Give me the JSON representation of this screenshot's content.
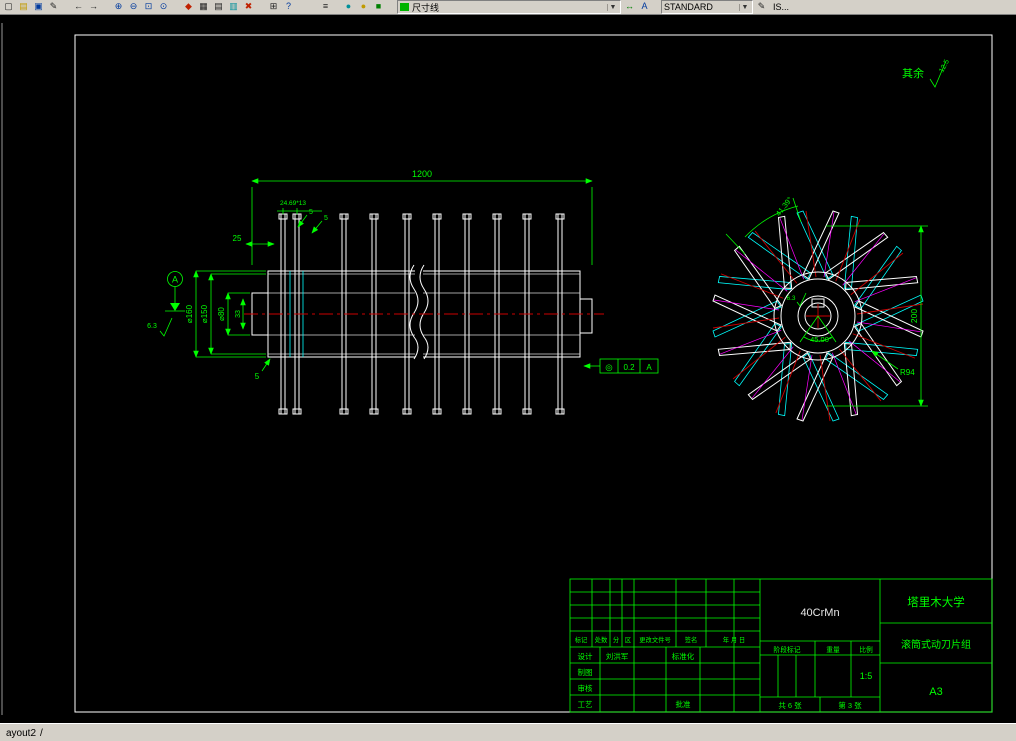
{
  "toolbar": {
    "icons": [
      {
        "name": "new-file-icon",
        "glyph": "▢"
      },
      {
        "name": "open-file-icon",
        "glyph": "▤"
      },
      {
        "name": "save-icon",
        "glyph": "▣"
      },
      {
        "name": "edit-pencil-icon",
        "glyph": "✎"
      },
      {
        "name": "undo-icon",
        "glyph": "←"
      },
      {
        "name": "redo-icon",
        "glyph": "→"
      },
      {
        "name": "zoom-in-icon",
        "glyph": "⊕"
      },
      {
        "name": "zoom-out-icon",
        "glyph": "⊖"
      },
      {
        "name": "zoom-window-icon",
        "glyph": "⊡"
      },
      {
        "name": "zoom-extents-icon",
        "glyph": "⊙"
      },
      {
        "name": "match-properties-icon",
        "glyph": "◆"
      },
      {
        "name": "table-icon",
        "glyph": "▦"
      },
      {
        "name": "table-style-icon",
        "glyph": "▤"
      },
      {
        "name": "sheet-set-icon",
        "glyph": "▥"
      },
      {
        "name": "erase-icon",
        "glyph": "✖"
      },
      {
        "name": "grid-icon",
        "glyph": "⊞"
      },
      {
        "name": "help-icon",
        "glyph": "?"
      },
      {
        "name": "layers-icon",
        "glyph": "≡"
      },
      {
        "name": "layer-color-cyan-icon",
        "glyph": "●"
      },
      {
        "name": "layer-color-yellow-icon",
        "glyph": "●"
      },
      {
        "name": "layer-color-green-icon",
        "glyph": "■"
      },
      {
        "name": "dimension-icon",
        "glyph": "↔"
      },
      {
        "name": "text-tool-icon",
        "glyph": "A"
      },
      {
        "name": "edit-text-icon",
        "glyph": "✎"
      }
    ],
    "dim_style": "尺寸线",
    "text_style": "STANDARD",
    "right_text": "IS...",
    "chevron": "▼"
  },
  "statusbar": {
    "tab": "ayout2",
    "sep": "/"
  },
  "note": {
    "label": "其余",
    "value": "12.5"
  },
  "side": {
    "len": "1200",
    "pitch": "24.69*13",
    "t5_top1": "5",
    "t5_top2": "5",
    "t25": "25",
    "d160": "⌀160",
    "d150": "⌀150",
    "d80": "⌀80",
    "t33": "33",
    "t5_bot": "5",
    "datum": "A",
    "finish": "6.3",
    "tol_sym": "◎",
    "tol_val": "0.2",
    "tol_ref": "A"
  },
  "end": {
    "angle1": "41.39°",
    "dia": "200",
    "angle2": "45.00°",
    "radius": "R94",
    "finish": "6.3"
  },
  "titleblock": {
    "material": "40CrMn",
    "org": "塔里木大学",
    "title": "滚筒式动刀片组",
    "size": "A3",
    "header": {
      "mark": "标记",
      "count": "处数",
      "zone_a": "分",
      "zone_b": "区",
      "doc_no": "更改文件号",
      "sign": "签名",
      "date": "年 月 日"
    },
    "left": {
      "design": "设计",
      "designer": "刘洪军",
      "standardize": "标准化",
      "draft": "制图",
      "check": "审核",
      "process": "工艺",
      "approve": "批准"
    },
    "right": {
      "stage": "阶段标记",
      "weight": "重量",
      "scale": "比例",
      "scale_value": "1:5",
      "sheets": "共 6 张",
      "sheet_no": "第 3 张"
    }
  }
}
